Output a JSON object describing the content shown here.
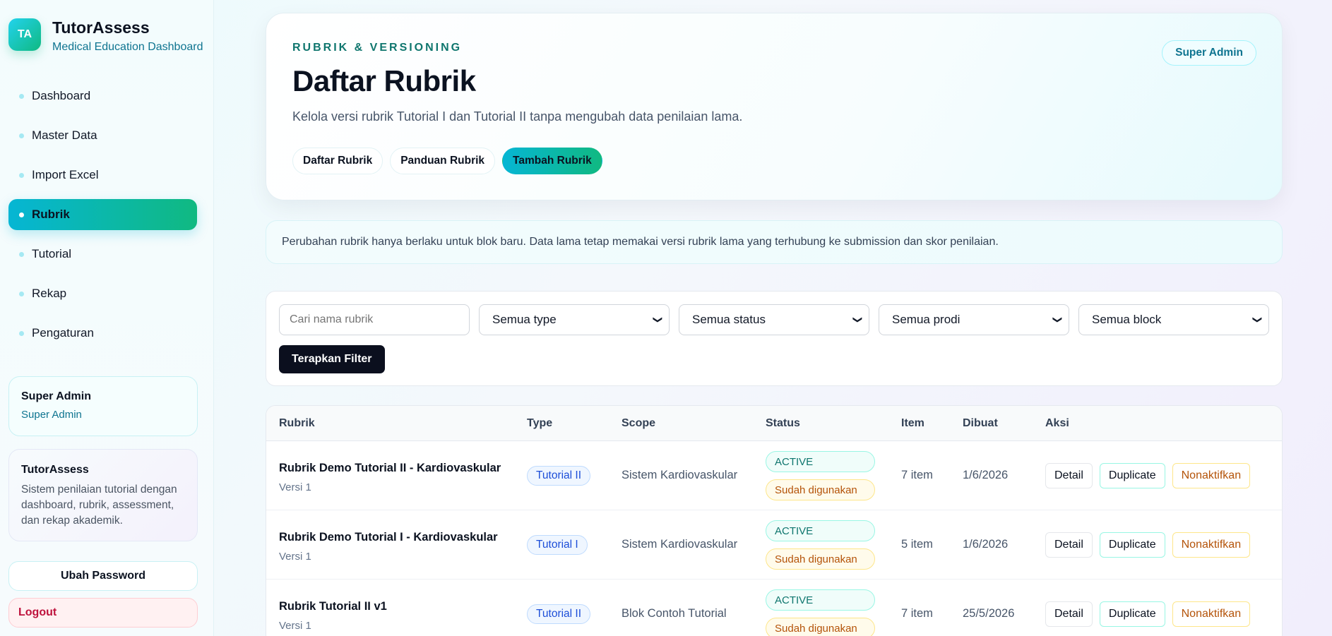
{
  "brand": {
    "logo": "TA",
    "title": "TutorAssess",
    "subtitle": "Medical Education Dashboard"
  },
  "nav": [
    {
      "label": "Dashboard",
      "active": false
    },
    {
      "label": "Master Data",
      "active": false
    },
    {
      "label": "Import Excel",
      "active": false
    },
    {
      "label": "Rubrik",
      "active": true
    },
    {
      "label": "Tutorial",
      "active": false
    },
    {
      "label": "Rekap",
      "active": false
    },
    {
      "label": "Pengaturan",
      "active": false
    }
  ],
  "user": {
    "name": "Super Admin",
    "role": "Super Admin"
  },
  "info": {
    "title": "TutorAssess",
    "desc": "Sistem penilaian tutorial dengan dashboard, rubrik, assessment, dan rekap akademik."
  },
  "sidebar_actions": {
    "password": "Ubah Password",
    "logout": "Logout"
  },
  "hero": {
    "eyebrow": "RUBRIK & VERSIONING",
    "title": "Daftar Rubrik",
    "desc": "Kelola versi rubrik Tutorial I dan Tutorial II tanpa mengubah data penilaian lama.",
    "role_badge": "Super Admin",
    "tabs": [
      "Daftar Rubrik",
      "Panduan Rubrik",
      "Tambah Rubrik"
    ]
  },
  "notice": "Perubahan rubrik hanya berlaku untuk blok baru. Data lama tetap memakai versi rubrik lama yang terhubung ke submission dan skor penilaian.",
  "filters": {
    "search_placeholder": "Cari nama rubrik",
    "type": "Semua type",
    "status": "Semua status",
    "prodi": "Semua prodi",
    "block": "Semua block",
    "apply": "Terapkan Filter"
  },
  "table": {
    "headers": [
      "Rubrik",
      "Type",
      "Scope",
      "Status",
      "Item",
      "Dibuat",
      "Aksi"
    ],
    "rows": [
      {
        "name": "Rubrik Demo Tutorial II - Kardiovaskular",
        "version": "Versi 1",
        "type": "Tutorial II",
        "scope": "Sistem Kardiovaskular",
        "status": "ACTIVE",
        "usage": "Sudah digunakan",
        "items": "7 item",
        "created": "1/6/2026"
      },
      {
        "name": "Rubrik Demo Tutorial I - Kardiovaskular",
        "version": "Versi 1",
        "type": "Tutorial I",
        "scope": "Sistem Kardiovaskular",
        "status": "ACTIVE",
        "usage": "Sudah digunakan",
        "items": "5 item",
        "created": "1/6/2026"
      },
      {
        "name": "Rubrik Tutorial II v1",
        "version": "Versi 1",
        "type": "Tutorial II",
        "scope": "Blok Contoh Tutorial",
        "status": "ACTIVE",
        "usage": "Sudah digunakan",
        "items": "7 item",
        "created": "25/5/2026"
      }
    ],
    "actions": {
      "detail": "Detail",
      "duplicate": "Duplicate",
      "deactivate": "Nonaktifkan"
    }
  },
  "colors": {
    "accent_start": "#06b6d4",
    "accent_end": "#10b981",
    "danger": "#be123c",
    "warning": "#b45309"
  }
}
